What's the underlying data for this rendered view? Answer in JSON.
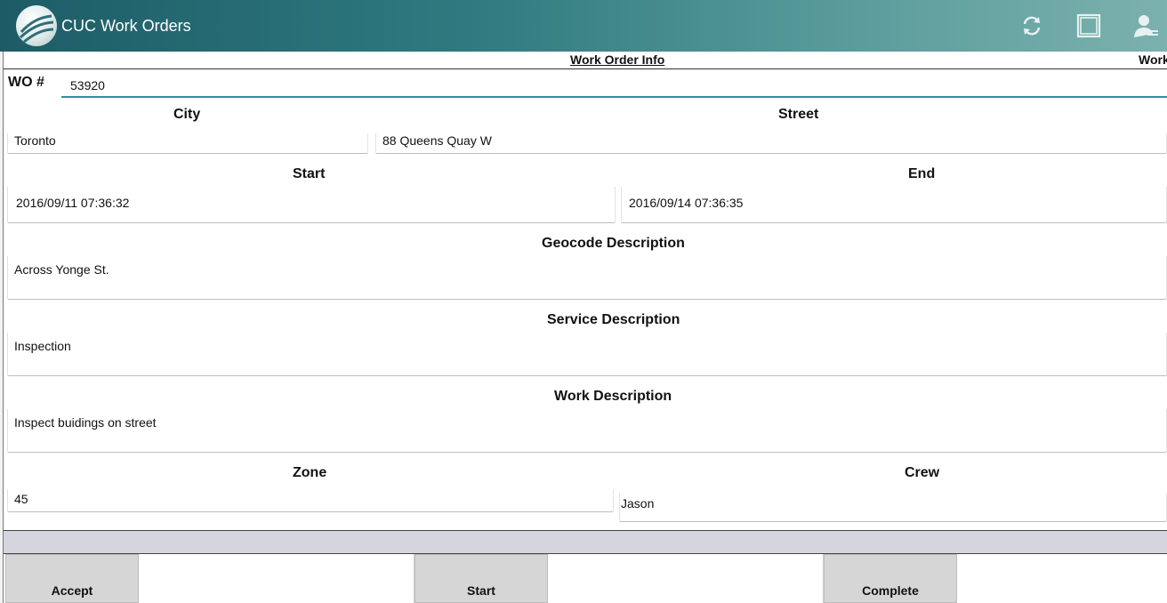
{
  "app": {
    "title": "CUC Work Orders",
    "header_color": "#2f7a80",
    "accent_color": "#2b8fa3"
  },
  "toolbar": {
    "icons": [
      "refresh-icon",
      "window-icon",
      "user-settings-icon"
    ]
  },
  "section": {
    "title": "Work Order Info",
    "title_2": "Work"
  },
  "form": {
    "wo_label": "WO #",
    "wo_value": "53920",
    "city_label": "City",
    "city_value": "Toronto",
    "street_label": "Street",
    "street_value": "88 Queens Quay W",
    "start_label": "Start",
    "start_value": "2016/09/11 07:36:32",
    "end_label": "End",
    "end_value": "2016/09/14 07:36:35",
    "geocode_label": "Geocode Description",
    "geocode_value": "Across Yonge St.",
    "service_label": "Service Description",
    "service_value": "Inspection",
    "work_label": "Work Description",
    "work_value": "Inspect buidings on street",
    "zone_label": "Zone",
    "zone_value": "45",
    "crew_label": "Crew",
    "crew_value": "Jason"
  },
  "actions": {
    "accept": "Accept",
    "start": "Start",
    "complete": "Complete"
  }
}
